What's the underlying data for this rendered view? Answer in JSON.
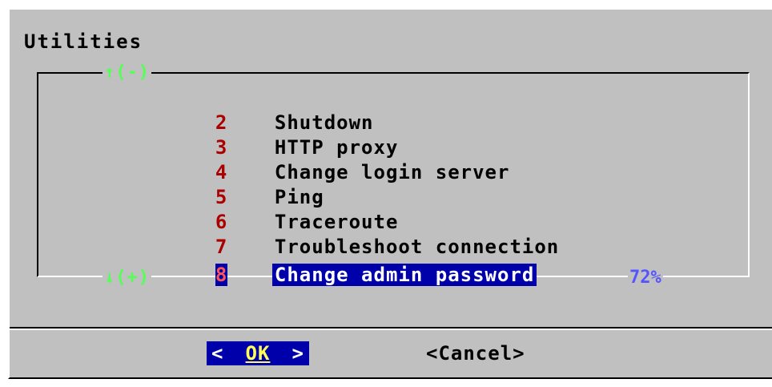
{
  "dialog": {
    "title": "Utilities",
    "scroll_up": "↑(-)",
    "scroll_down": "↓(+)",
    "scroll_percent": "72%"
  },
  "menu": {
    "items": [
      {
        "key": "2",
        "label": "Shutdown"
      },
      {
        "key": "3",
        "label": "HTTP proxy"
      },
      {
        "key": "4",
        "label": "Change login server"
      },
      {
        "key": "5",
        "label": "Ping"
      },
      {
        "key": "6",
        "label": "Traceroute"
      },
      {
        "key": "7",
        "label": "Troubleshoot connection"
      },
      {
        "key": "8",
        "label": "Change admin password",
        "selected": true
      }
    ]
  },
  "buttons": {
    "ok": {
      "left": "<",
      "label": "OK",
      "right": ">"
    },
    "cancel": {
      "label": "<Cancel>"
    }
  },
  "colors": {
    "background": "#c0c0c0",
    "highlight": "#0000aa",
    "hotkey": "#aa0000",
    "scroll_indicator": "#55ff55",
    "percent": "#5555ff"
  }
}
